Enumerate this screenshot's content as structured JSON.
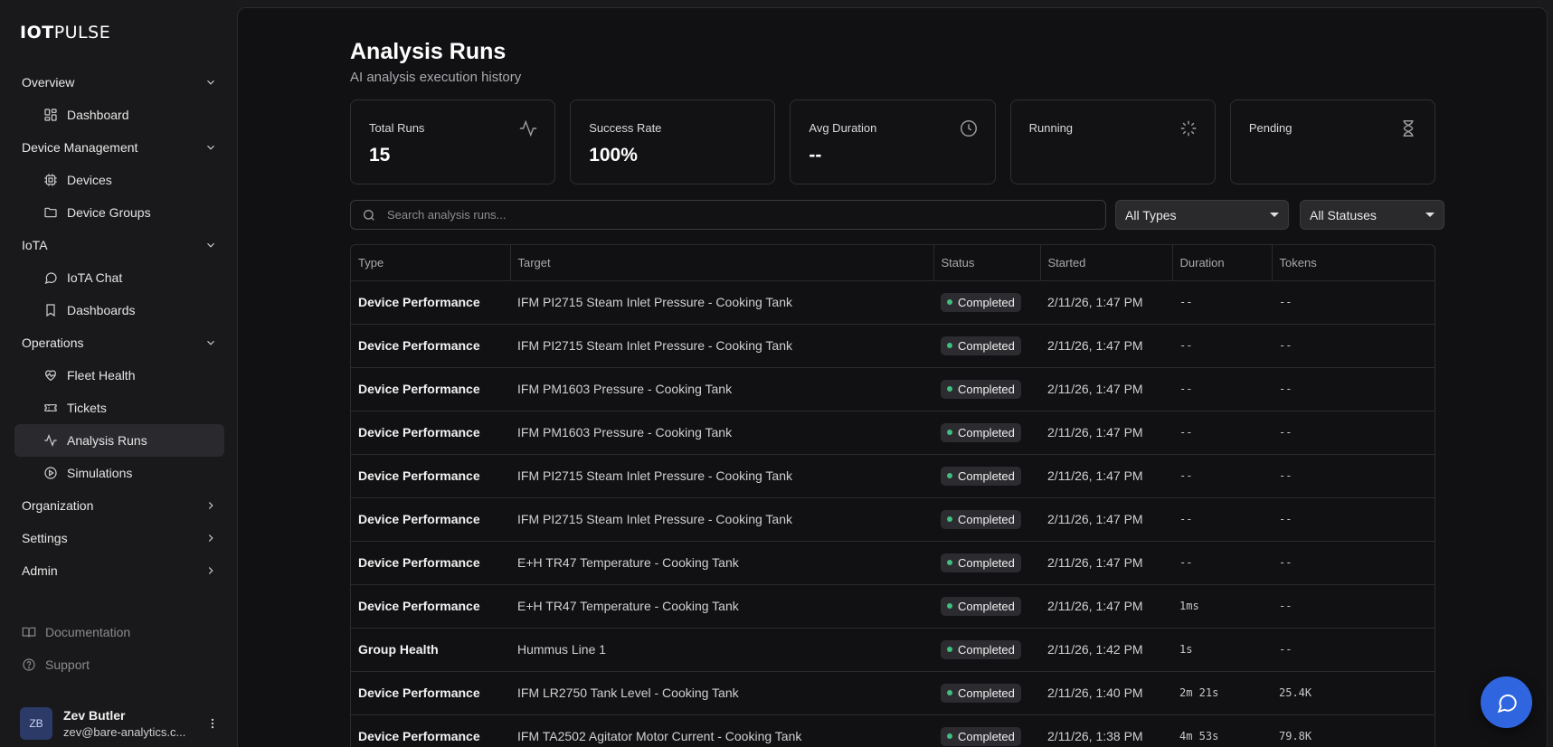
{
  "brand": {
    "bold": "IOT",
    "light": "PULSE"
  },
  "sidebar": {
    "groups": [
      {
        "label": "Overview",
        "expanded": true,
        "items": [
          {
            "label": "Dashboard",
            "icon": "dashboard-grid-icon"
          }
        ]
      },
      {
        "label": "Device Management",
        "expanded": true,
        "items": [
          {
            "label": "Devices",
            "icon": "chip-icon"
          },
          {
            "label": "Device Groups",
            "icon": "folder-icon"
          }
        ]
      },
      {
        "label": "IoTA",
        "expanded": true,
        "items": [
          {
            "label": "IoTA Chat",
            "icon": "chat-bubble-icon"
          },
          {
            "label": "Dashboards",
            "icon": "bookmark-icon"
          }
        ]
      },
      {
        "label": "Operations",
        "expanded": true,
        "items": [
          {
            "label": "Fleet Health",
            "icon": "heart-pulse-icon"
          },
          {
            "label": "Tickets",
            "icon": "ticket-icon"
          },
          {
            "label": "Analysis Runs",
            "icon": "activity-icon",
            "active": true
          },
          {
            "label": "Simulations",
            "icon": "play-circle-icon"
          }
        ]
      },
      {
        "label": "Organization",
        "expanded": false,
        "items": []
      },
      {
        "label": "Settings",
        "expanded": false,
        "items": []
      },
      {
        "label": "Admin",
        "expanded": false,
        "items": []
      }
    ],
    "footer_links": [
      {
        "label": "Documentation",
        "icon": "book-open-icon"
      },
      {
        "label": "Support",
        "icon": "help-circle-icon"
      }
    ],
    "user": {
      "initials": "ZB",
      "name": "Zev Butler",
      "email": "zev@bare-analytics.c..."
    }
  },
  "page": {
    "title": "Analysis Runs",
    "subtitle": "AI analysis execution history"
  },
  "stats": [
    {
      "label": "Total Runs",
      "value": "15",
      "icon": "activity-icon"
    },
    {
      "label": "Success Rate",
      "value": "100%",
      "icon": ""
    },
    {
      "label": "Avg Duration",
      "value": "--",
      "icon": "clock-icon"
    },
    {
      "label": "Running",
      "value": "",
      "icon": "loader-icon"
    },
    {
      "label": "Pending",
      "value": "",
      "icon": "hourglass-icon"
    }
  ],
  "filters": {
    "search_placeholder": "Search analysis runs...",
    "type_select": "All Types",
    "status_select": "All Statuses"
  },
  "table": {
    "columns": [
      "Type",
      "Target",
      "Status",
      "Started",
      "Duration",
      "Tokens"
    ],
    "rows": [
      {
        "type": "Device Performance",
        "target": "IFM PI2715 Steam Inlet Pressure - Cooking Tank",
        "status": "Completed",
        "started": "2/11/26, 1:47 PM",
        "duration": "--",
        "tokens": "--"
      },
      {
        "type": "Device Performance",
        "target": "IFM PI2715 Steam Inlet Pressure - Cooking Tank",
        "status": "Completed",
        "started": "2/11/26, 1:47 PM",
        "duration": "--",
        "tokens": "--"
      },
      {
        "type": "Device Performance",
        "target": "IFM PM1603 Pressure - Cooking Tank",
        "status": "Completed",
        "started": "2/11/26, 1:47 PM",
        "duration": "--",
        "tokens": "--"
      },
      {
        "type": "Device Performance",
        "target": "IFM PM1603 Pressure - Cooking Tank",
        "status": "Completed",
        "started": "2/11/26, 1:47 PM",
        "duration": "--",
        "tokens": "--"
      },
      {
        "type": "Device Performance",
        "target": "IFM PI2715 Steam Inlet Pressure - Cooking Tank",
        "status": "Completed",
        "started": "2/11/26, 1:47 PM",
        "duration": "--",
        "tokens": "--"
      },
      {
        "type": "Device Performance",
        "target": "IFM PI2715 Steam Inlet Pressure - Cooking Tank",
        "status": "Completed",
        "started": "2/11/26, 1:47 PM",
        "duration": "--",
        "tokens": "--"
      },
      {
        "type": "Device Performance",
        "target": "E+H TR47 Temperature - Cooking Tank",
        "status": "Completed",
        "started": "2/11/26, 1:47 PM",
        "duration": "--",
        "tokens": "--"
      },
      {
        "type": "Device Performance",
        "target": "E+H TR47 Temperature - Cooking Tank",
        "status": "Completed",
        "started": "2/11/26, 1:47 PM",
        "duration": "1ms",
        "tokens": "--"
      },
      {
        "type": "Group Health",
        "target": "Hummus Line 1",
        "status": "Completed",
        "started": "2/11/26, 1:42 PM",
        "duration": "1s",
        "tokens": "--"
      },
      {
        "type": "Device Performance",
        "target": "IFM LR2750 Tank Level - Cooking Tank",
        "status": "Completed",
        "started": "2/11/26, 1:40 PM",
        "duration": "2m 21s",
        "tokens": "25.4K"
      },
      {
        "type": "Device Performance",
        "target": "IFM TA2502 Agitator Motor Current - Cooking Tank",
        "status": "Completed",
        "started": "2/11/26, 1:38 PM",
        "duration": "4m 53s",
        "tokens": "79.8K"
      }
    ]
  },
  "colors": {
    "accent": "#2f66e0",
    "status_completed": "#3fbf7f",
    "background": "#111113"
  }
}
